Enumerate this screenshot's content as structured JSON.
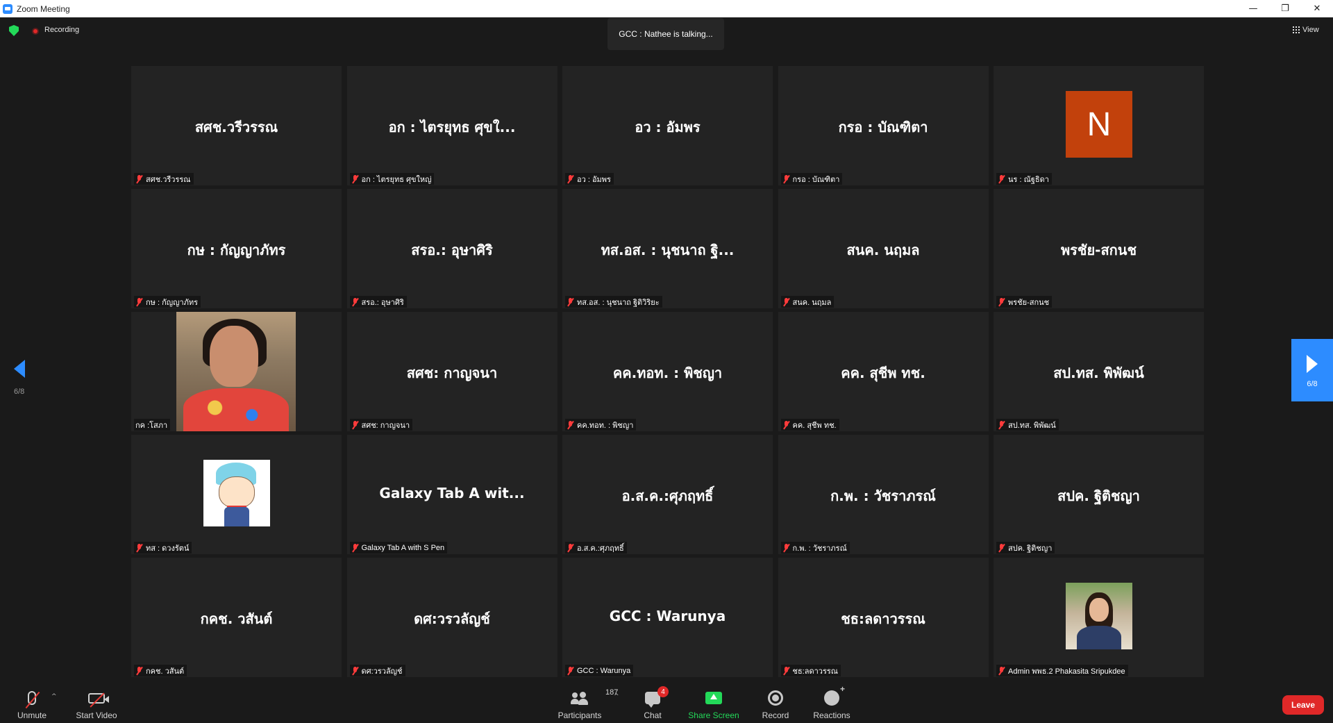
{
  "window": {
    "title": "Zoom Meeting",
    "controls": {
      "minimize": "—",
      "restore": "❐",
      "close": "✕"
    }
  },
  "topbar": {
    "recording_label": "Recording",
    "talking": "GCC : Nathee is talking...",
    "view_label": "View"
  },
  "pager": {
    "left_count": "6/8",
    "right_count": "6/8"
  },
  "tiles": [
    {
      "big": "สศช.วรีวรรณ",
      "name": "สศช.วรีวรรณ",
      "muted": true
    },
    {
      "big": "อก : ไตรยุทธ ศุขใ...",
      "name": "อก : ไตรยุทธ ศุขใหญ่",
      "muted": true
    },
    {
      "big": "อว : อัมพร",
      "name": "อว : อัมพร",
      "muted": true
    },
    {
      "big": "กรอ : บัณฑิตา",
      "name": "กรอ : บัณฑิตา",
      "muted": true
    },
    {
      "big": "",
      "avatar_letter": "N",
      "name": "นร : ณัฐธิดา",
      "muted": true
    },
    {
      "big": "กษ : กัญญาภัทร",
      "name": "กษ : กัญญาภัทร",
      "muted": true
    },
    {
      "big": "สรอ.: อุษาศิริ",
      "name": "สรอ.: อุษาศิริ",
      "muted": true
    },
    {
      "big": "ทส.อส. : นุชนาถ ฐิ...",
      "name": "ทส.อส. : นุชนาถ ฐิติวิริยะ",
      "muted": true
    },
    {
      "big": "สนค. นฤมล",
      "name": "สนค. นฤมล",
      "muted": true
    },
    {
      "big": "พรชัย-สกนช",
      "name": "พรชัย-สกนช",
      "muted": true
    },
    {
      "big": "",
      "photo": "woman",
      "name": "กค :โสภา",
      "muted": false
    },
    {
      "big": "สศช: กาญจนา",
      "name": "สศช: กาญจนา",
      "muted": true
    },
    {
      "big": "คค.ทอท. : พิชญา",
      "name": "คค.ทอท. : พิชญา",
      "muted": true
    },
    {
      "big": "คค. สุชีพ ทช.",
      "name": "คค. สุชีพ ทช.",
      "muted": true
    },
    {
      "big": "สป.ทส. พิพัฒน์",
      "name": "สป.ทส. พิพัฒน์",
      "muted": true
    },
    {
      "big": "",
      "photo": "cartoon",
      "name": "ทส : ดวงรัตน์",
      "muted": true
    },
    {
      "big": "Galaxy Tab A wit...",
      "name": "Galaxy Tab A with S Pen",
      "muted": true
    },
    {
      "big": "อ.ส.ค.:ศุภฤทธิ์",
      "name": "อ.ส.ค.:ศุภฤทธิ์",
      "muted": true
    },
    {
      "big": "ก.พ. : วัชราภรณ์",
      "name": "ก.พ. : วัชราภรณ์",
      "muted": true
    },
    {
      "big": "สปค. ฐิติชญา",
      "name": "สปค. ฐิติชญา",
      "muted": true
    },
    {
      "big": "กคช. วสันต์",
      "name": "กคช. วสันต์",
      "muted": true
    },
    {
      "big": "ดศ:วรวลัญช์",
      "name": "ดศ:วรวลัญช์",
      "muted": true
    },
    {
      "big": "GCC : Warunya",
      "name": "GCC : Warunya",
      "muted": true
    },
    {
      "big": "ชธ:ลดาวรรณ",
      "name": "ชธ:ลดาวรรณ",
      "muted": true
    },
    {
      "big": "",
      "photo": "girl",
      "name": "Admin พพธ.2 Phakasita Sripukdee",
      "muted": true
    }
  ],
  "toolbar": {
    "unmute": "Unmute",
    "start_video": "Start Video",
    "participants": "Participants",
    "participants_count": "187",
    "chat": "Chat",
    "chat_badge": "4",
    "share_screen": "Share Screen",
    "record": "Record",
    "reactions": "Reactions",
    "leave": "Leave",
    "caret": "^"
  },
  "colors": {
    "accent": "#2d8cff",
    "leave": "#e02828",
    "share": "#23d959",
    "avatar_n": "#c2410c"
  }
}
